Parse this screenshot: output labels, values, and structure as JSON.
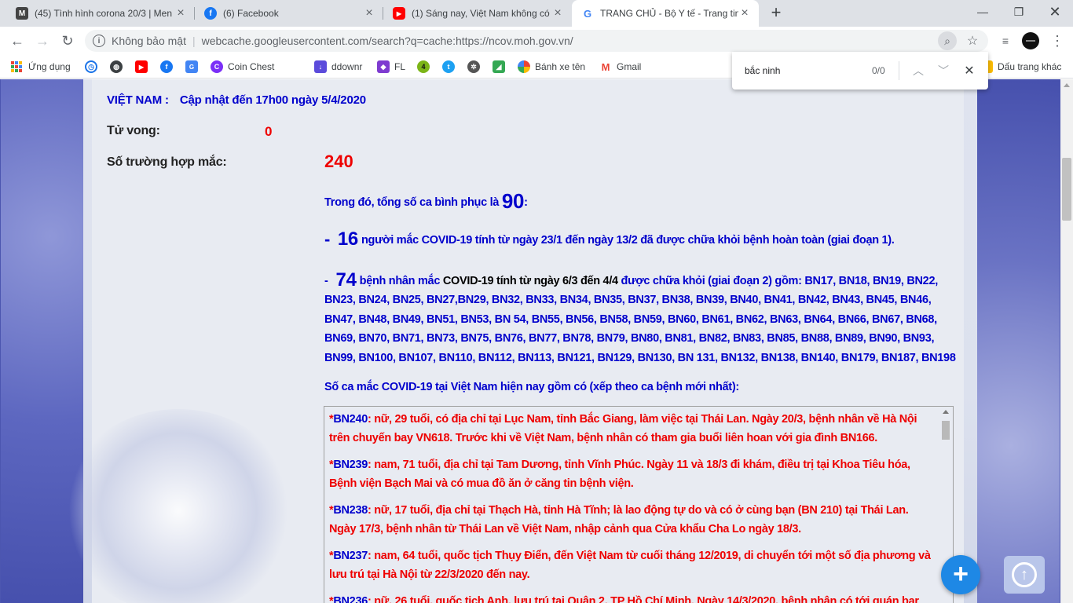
{
  "browser": {
    "tabs": [
      {
        "title": "(45) Tình hình corona 20/3 | Men",
        "icon": "m-icon"
      },
      {
        "title": "(6) Facebook",
        "icon": "facebook-icon"
      },
      {
        "title": "(1) Sáng nay, Việt Nam không có",
        "icon": "youtube-icon"
      },
      {
        "title": "TRANG CHỦ - Bộ Y tế - Trang tin",
        "icon": "google-icon"
      }
    ],
    "new_tab_glyph": "+",
    "address": {
      "security": "Không bảo mật",
      "url": "webcache.googleusercontent.com/search?q=cache:https://ncov.moh.gov.vn/"
    },
    "bookmarks": [
      {
        "label": "Ứng dụng"
      },
      {
        "label": ""
      },
      {
        "label": ""
      },
      {
        "label": ""
      },
      {
        "label": ""
      },
      {
        "label": ""
      },
      {
        "label": "Coin Chest"
      },
      {
        "label": "ddownr"
      },
      {
        "label": "FL"
      },
      {
        "label": ""
      },
      {
        "label": ""
      },
      {
        "label": ""
      },
      {
        "label": ""
      },
      {
        "label": "Bánh xe tên"
      },
      {
        "label": "Gmail"
      }
    ],
    "other_bookmarks": "Dấu trang khác",
    "find": {
      "query": "bắc ninh",
      "count": "0/0"
    }
  },
  "page": {
    "country": "VIỆT NAM :",
    "updated": "Cập nhật đến 17h00 ngày 5/4/2020",
    "deaths_label": "Tử vong:",
    "deaths_value": "0",
    "cases_label": "Số trường hợp mắc:",
    "cases_value": "240",
    "recovered_prefix": "Trong đó, tổng số ca bình phục là ",
    "recovered_value": "90",
    "recovered_suffix": ":",
    "phase1_dash": "- ",
    "phase1_value": "16",
    "phase1_text": "người mắc COVID-19 tính từ ngày 23/1 đến ngày 13/2 đã được chữa khỏi bệnh hoàn toàn (giai đoạn 1).",
    "phase2_dash": "-",
    "phase2_value": "74",
    "phase2_a": "bệnh nhân mắc ",
    "phase2_b": "COVID-19 tính từ ngày 6/3 đến 4/4",
    "phase2_c": " được chữa khỏi (giai đoạn 2) gồm: BN17, BN18, BN19, BN22, BN23, BN24, BN25, BN27,BN29, BN32, BN33, BN34, BN35, BN37, BN38, BN39, BN40, BN41, BN42, BN43, BN45, BN46, BN47, BN48, BN49, BN51, BN53, BN 54, BN55, BN56, BN58, BN59, BN60, BN61, BN62, BN63, BN64, BN66, BN67, BN68, BN69, BN70, BN71, BN73, BN75, BN76, BN77, BN78, BN79, BN80, BN81, BN82, BN83, BN85, BN88, BN89, BN90, BN93, BN99, BN100, BN107, BN110, BN112, BN113, BN121, BN129, BN130, BN 131, BN132, BN138, BN140, BN179, BN187, BN198",
    "list_heading": "Số ca mắc COVID-19 tại Việt Nam hiện nay gồm có (xếp theo ca bệnh mới nhất):",
    "entries": [
      {
        "star": "*",
        "id": "BN240",
        "text": ": nữ, 29 tuổi, có địa chỉ tại Lục Nam, tỉnh Bắc Giang, làm việc tại Thái Lan. Ngày 20/3, bệnh nhân về Hà Nội trên chuyến bay VN618. Trước khi về Việt Nam, bệnh nhân có tham gia buổi liên hoan với gia đình BN166."
      },
      {
        "star": "*",
        "id": "BN239",
        "text": ": nam, 71 tuổi, địa chỉ tại Tam Dương, tỉnh Vĩnh Phúc.  Ngày 11 và 18/3 đi khám, điều trị tại Khoa Tiêu hóa, Bệnh viện Bạch Mai và có mua đồ ăn ở căng tin bệnh viện."
      },
      {
        "star": "*",
        "id": "BN238",
        "text": ": nữ, 17 tuổi, địa chỉ tại Thạch Hà, tỉnh Hà Tĩnh; là lao động tự do và có ở cùng bạn (BN 210) tại Thái Lan. Ngày 17/3, bệnh nhân từ Thái Lan về Việt Nam, nhập cảnh qua Cửa khẩu Cha Lo ngày 18/3."
      },
      {
        "star": "*",
        "id": "BN237",
        "text": ": nam, 64 tuổi, quốc tịch Thụy Điển, đến Việt Nam từ cuối tháng 12/2019, di chuyển tới một số địa phương và lưu trú tại Hà Nội từ 22/3/2020 đến nay."
      },
      {
        "star": "*",
        "id": "BN236",
        "text": ": nữ, 26 tuổi, quốc tịch Anh, lưu trú tại Quận 2, TP Hồ Chí Minh. Ngày 14/3/2020, bệnh nhân có tới quán bar"
      }
    ],
    "fab_glyph": "+",
    "top_glyph": "↑"
  }
}
